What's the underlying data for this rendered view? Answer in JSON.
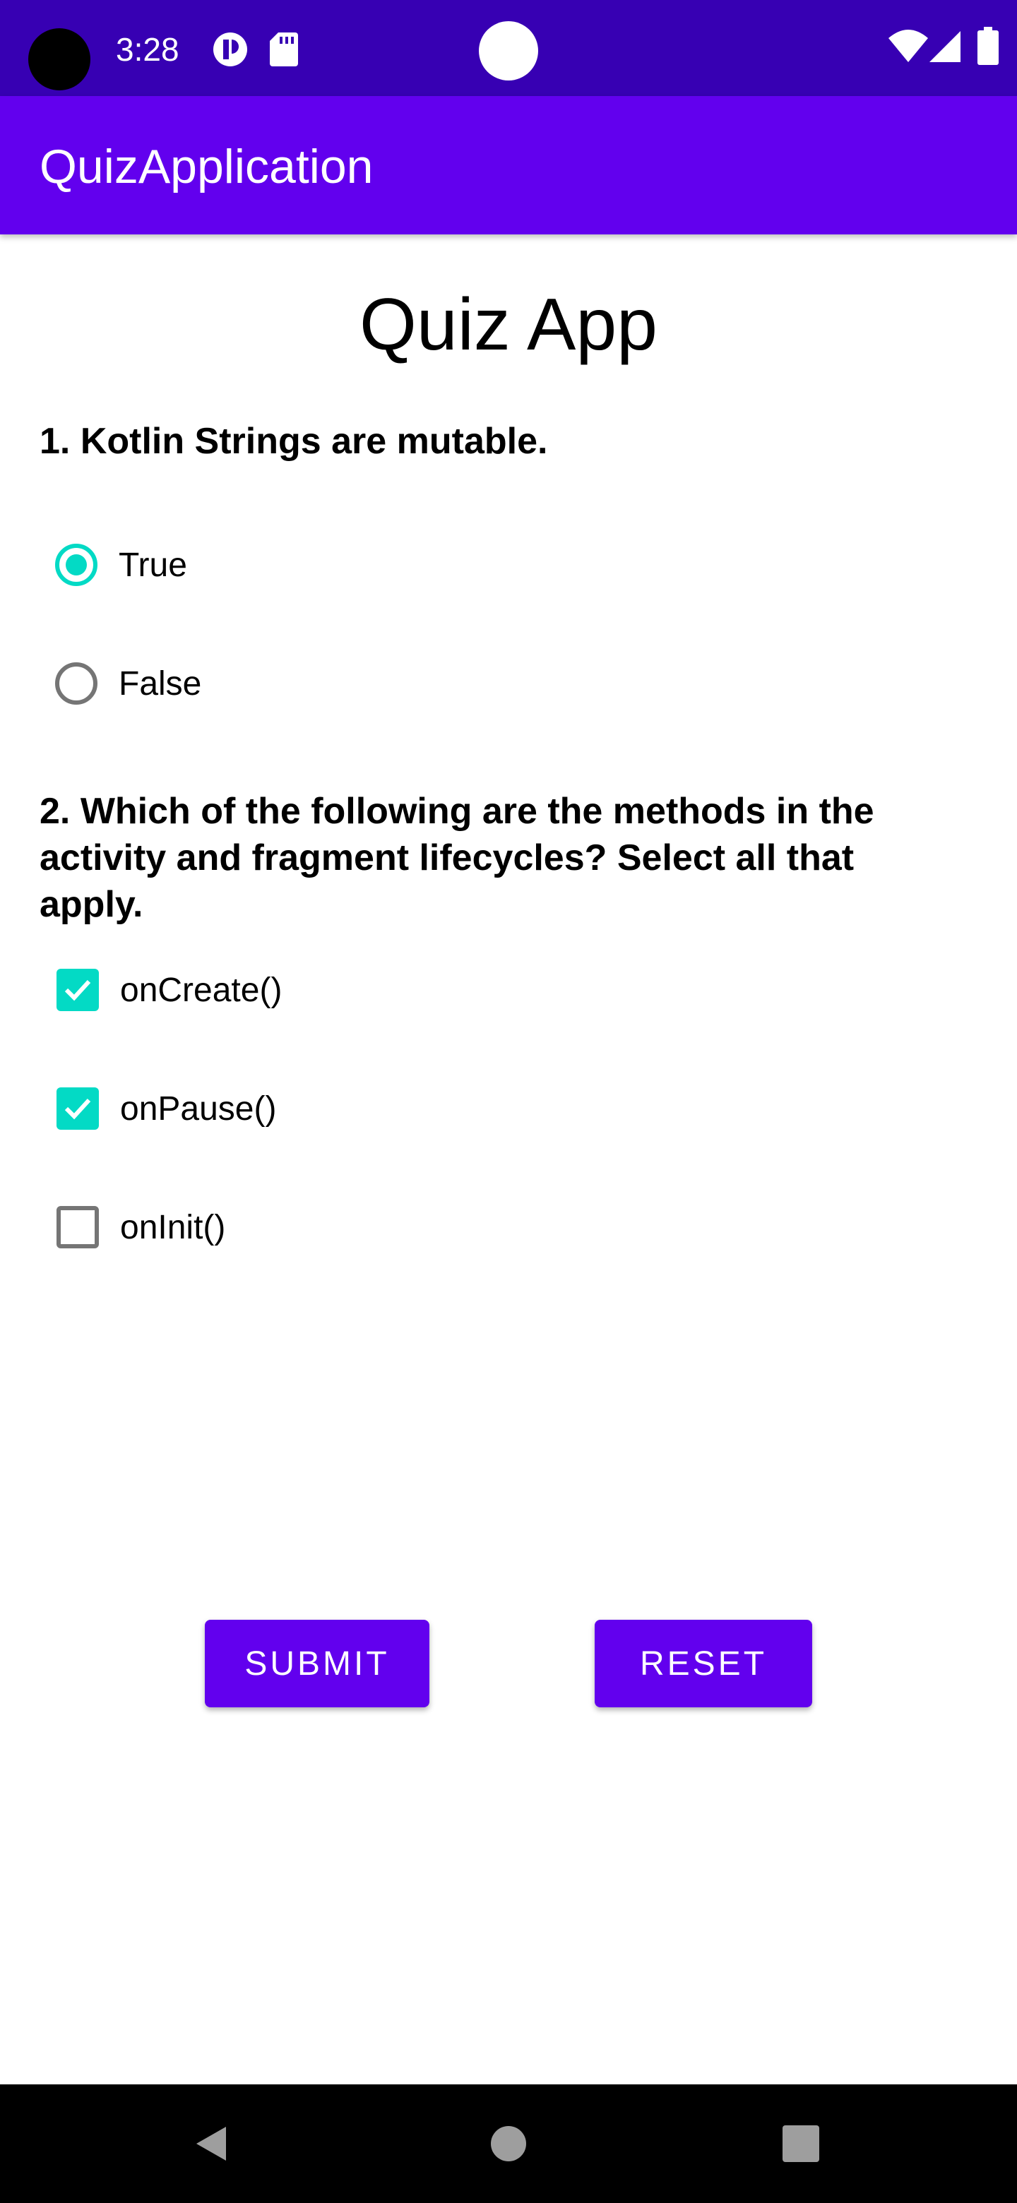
{
  "status_bar": {
    "time": "3:28",
    "icons": [
      "notification-icon",
      "sd-card-icon",
      "wifi-icon",
      "signal-icon",
      "battery-icon"
    ]
  },
  "app_bar": {
    "title": "QuizApplication"
  },
  "main": {
    "title": "Quiz App",
    "question1": {
      "text": "1. Kotlin Strings are mutable.",
      "options": [
        {
          "label": "True",
          "selected": true
        },
        {
          "label": "False",
          "selected": false
        }
      ]
    },
    "question2": {
      "text": "2. Which of the following are the methods in the activity and fragment lifecycles? Select all that apply.",
      "options": [
        {
          "label": "onCreate()",
          "checked": true
        },
        {
          "label": "onPause()",
          "checked": true
        },
        {
          "label": "onInit()",
          "checked": false
        }
      ]
    },
    "buttons": {
      "submit": "SUBMIT",
      "reset": "RESET"
    }
  },
  "nav_bar": {
    "icons": [
      "back-icon",
      "home-icon",
      "recents-icon"
    ]
  },
  "colors": {
    "status_bar": "#3700b3",
    "primary": "#6200ee",
    "accent": "#03dac5",
    "unchecked": "#757575",
    "nav_bar": "#000000"
  }
}
